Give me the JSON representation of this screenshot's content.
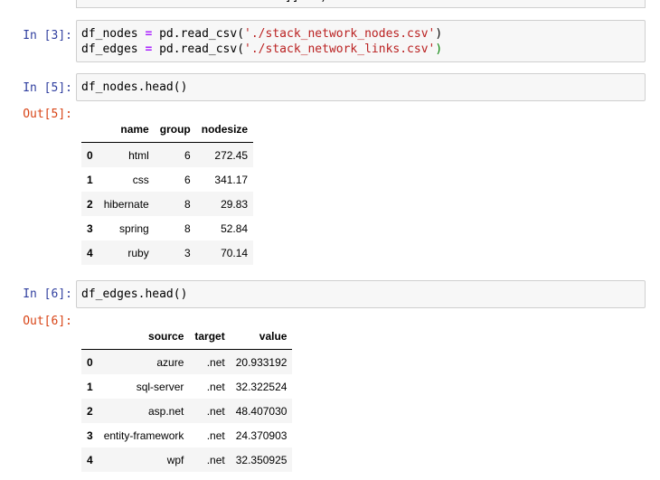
{
  "top_clip": {
    "text": "]]...)"
  },
  "cells": [
    {
      "prompt": "In [3]:",
      "lines": [
        [
          {
            "t": "df_nodes ",
            "c": ""
          },
          {
            "t": "=",
            "c": "op"
          },
          {
            "t": " pd.read_csv(",
            "c": ""
          },
          {
            "t": "'./stack_network_nodes.csv'",
            "c": "str"
          },
          {
            "t": ")",
            "c": ""
          }
        ],
        [
          {
            "t": "df_edges ",
            "c": ""
          },
          {
            "t": "=",
            "c": "op"
          },
          {
            "t": " pd.read_csv(",
            "c": ""
          },
          {
            "t": "'./stack_network_links.csv'",
            "c": "str"
          },
          {
            "t": ")",
            "c": "paren-g"
          }
        ]
      ]
    },
    {
      "prompt": "In [5]:",
      "lines": [
        [
          {
            "t": "df_nodes.head()",
            "c": ""
          }
        ]
      ],
      "out_prompt": "Out[5]:",
      "table": {
        "columns": [
          "",
          "name",
          "group",
          "nodesize"
        ],
        "rows": [
          [
            "0",
            "html",
            "6",
            "272.45"
          ],
          [
            "1",
            "css",
            "6",
            "341.17"
          ],
          [
            "2",
            "hibernate",
            "8",
            "29.83"
          ],
          [
            "3",
            "spring",
            "8",
            "52.84"
          ],
          [
            "4",
            "ruby",
            "3",
            "70.14"
          ]
        ]
      }
    },
    {
      "prompt": "In [6]:",
      "lines": [
        [
          {
            "t": "df_edges.head()",
            "c": ""
          }
        ]
      ],
      "out_prompt": "Out[6]:",
      "table": {
        "columns": [
          "",
          "source",
          "target",
          "value"
        ],
        "rows": [
          [
            "0",
            "azure",
            ".net",
            "20.933192"
          ],
          [
            "1",
            "sql-server",
            ".net",
            "32.322524"
          ],
          [
            "2",
            "asp.net",
            ".net",
            "48.407030"
          ],
          [
            "3",
            "entity-framework",
            ".net",
            "24.370903"
          ],
          [
            "4",
            "wpf",
            ".net",
            "32.350925"
          ]
        ]
      }
    }
  ]
}
